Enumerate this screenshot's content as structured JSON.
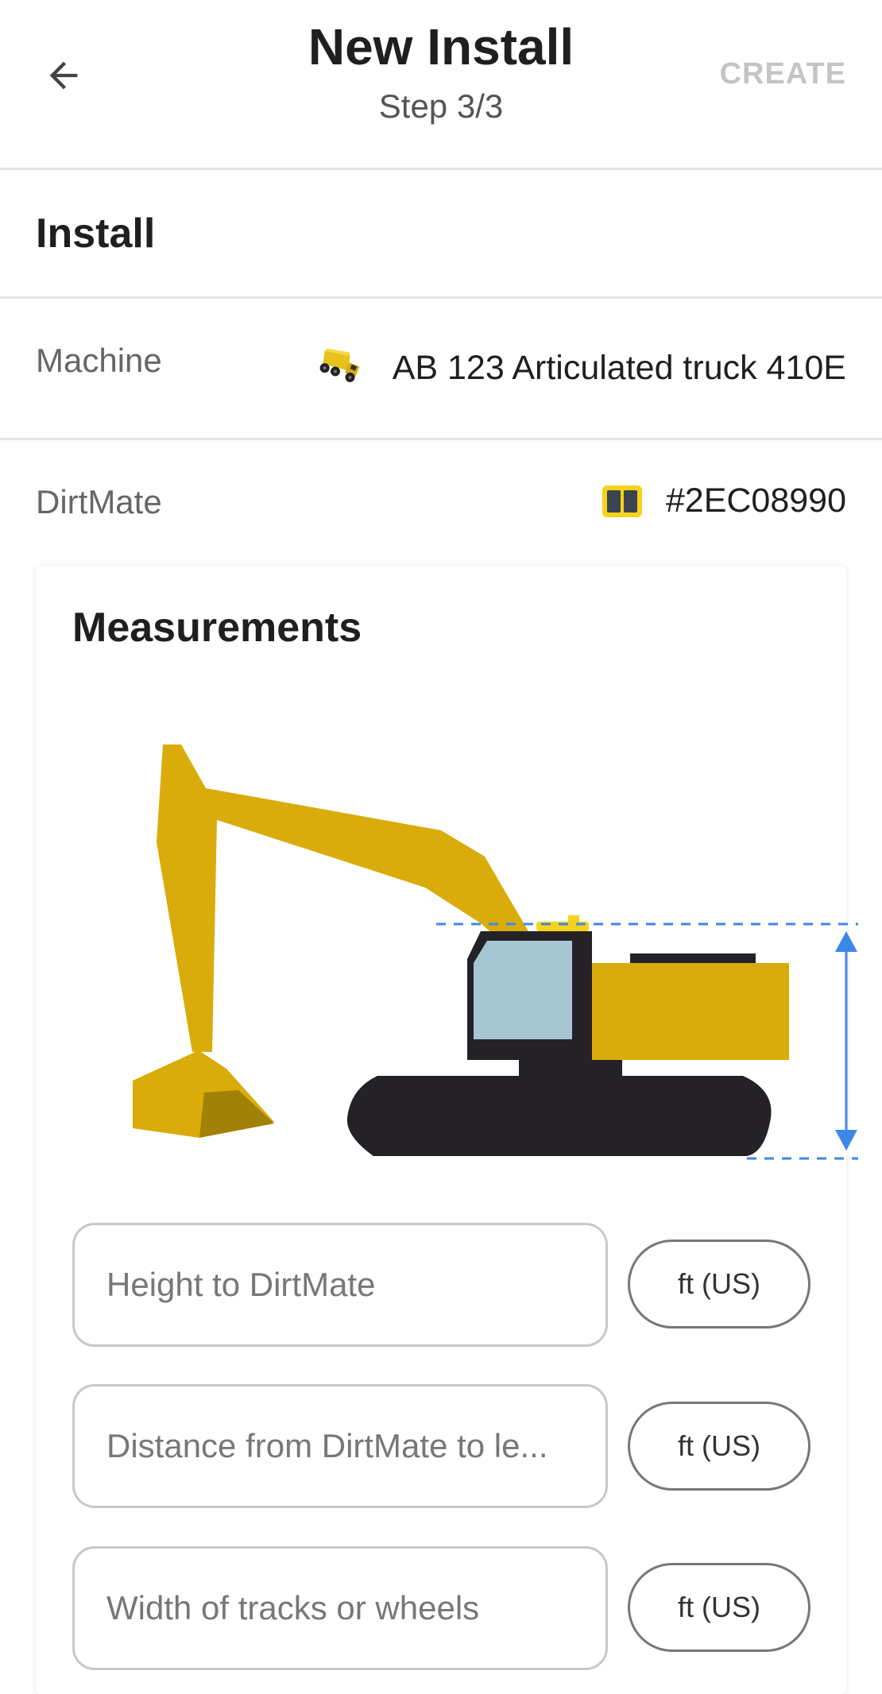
{
  "header": {
    "title": "New Install",
    "subtitle": "Step 3/3",
    "back_icon": "arrow-left-icon",
    "create_label": "CREATE"
  },
  "section": {
    "title": "Install"
  },
  "machine": {
    "label": "Machine",
    "icon": "articulated-truck-icon",
    "value": "AB 123 Articulated truck 410E"
  },
  "dirtmate": {
    "label": "DirtMate",
    "icon": "dirtmate-device-icon",
    "value": "#2EC08990"
  },
  "measurements": {
    "title": "Measurements",
    "fields": [
      {
        "placeholder": "Height to DirtMate",
        "unit": "ft (US)"
      },
      {
        "placeholder": "Distance from DirtMate to le...",
        "unit": "ft (US)"
      },
      {
        "placeholder": "Width of tracks or wheels",
        "unit": "ft (US)"
      }
    ]
  },
  "colors": {
    "machine_yellow": "#d9ac0b",
    "accent_blue": "#3d87e8",
    "disabled_text": "#c4c4c4"
  }
}
